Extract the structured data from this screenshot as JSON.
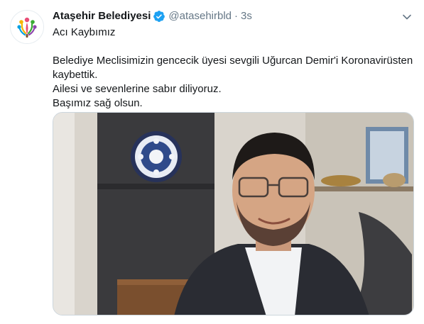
{
  "tweet": {
    "author": {
      "display_name": "Ataşehir Belediyesi",
      "handle": "@atasehirbld",
      "verified": true,
      "avatar_icon": "municipality-logo-icon"
    },
    "separator": "·",
    "timestamp": "3s",
    "text": {
      "title_line": "Acı Kaybımız",
      "line_1": "Belediye Meclisimizin gencecik üyesi sevgili Uğurcan Demir'i Koronavirüsten kaybettik.",
      "line_2": "Ailesi ve sevenlerine sabır diliyoruz.",
      "line_3": "Başımız sağ olsun."
    },
    "media": {
      "type": "photo"
    },
    "menu_icon": "chevron-down-icon"
  },
  "colors": {
    "text_primary": "#14171a",
    "text_secondary": "#657786",
    "verified_blue": "#1da1f2",
    "border": "#ccd6dd"
  }
}
